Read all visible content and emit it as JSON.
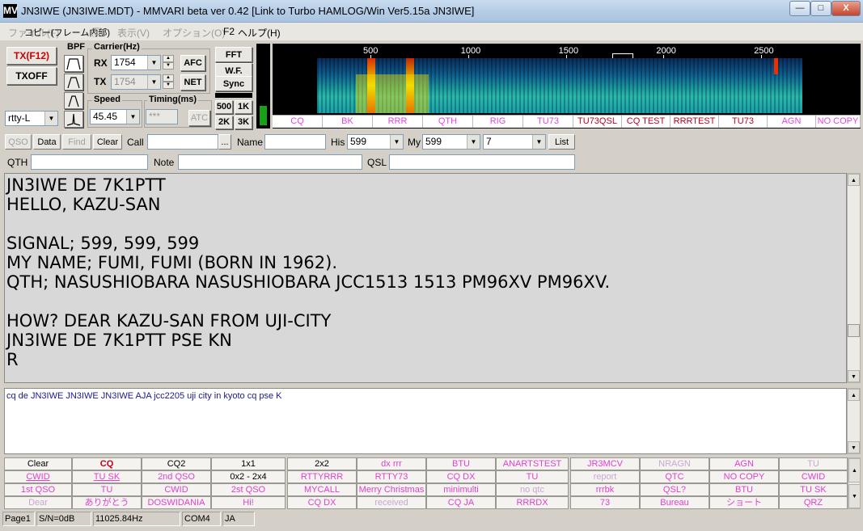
{
  "window": {
    "title": "JN3IWE (JN3IWE.MDT) - MMVARI beta ver 0.42 [Link to Turbo HAMLOG/Win Ver5.15a JN3IWE]",
    "icon_label": "MV",
    "minimize_label": "—",
    "maximize_label": "□",
    "close_label": "X"
  },
  "menu": [
    {
      "label": "ファイル(F)"
    },
    {
      "label": "コピー(フレーム内部)"
    },
    {
      "label": "(E)"
    },
    {
      "label": "表示(V)"
    },
    {
      "label": "オプション(O)"
    },
    {
      "label": "F2"
    },
    {
      "label": "ヘルプ(H)"
    }
  ],
  "controls": {
    "tx_button": "TX(F12)",
    "txoff_button": "TXOFF",
    "bpf_label": "BPF",
    "mode_value": "rtty-L",
    "carrier_label": "Carrier(Hz)",
    "rx_label": "RX",
    "rx_value": "1754",
    "tx_label": "TX",
    "tx_value": "1754",
    "afc_button": "AFC",
    "net_button": "NET",
    "speed_label": "Speed",
    "speed_value": "45.45",
    "timing_label": "Timing(ms)",
    "timing_value": "***",
    "atc_button": "ATC",
    "fft_button": "FFT",
    "wf_button": "W.F.",
    "sync_button": "Sync",
    "b500_button": "500",
    "b1k_button": "1K",
    "b2k_button": "2K",
    "b3k_button": "3K"
  },
  "spectrum": {
    "scale": [
      {
        "label": "500",
        "hz": 500
      },
      {
        "label": "1000",
        "hz": 1000
      },
      {
        "label": "1500",
        "hz": 1500
      },
      {
        "label": "2000",
        "hz": 2000
      },
      {
        "label": "2500",
        "hz": 2500
      }
    ],
    "quick_macros": [
      "CQ",
      "BK",
      "RRR",
      "QTH",
      "RIG",
      "TU73",
      "TU73QSL",
      "CQ TEST",
      "RRRTEST",
      "TU73",
      "AGN",
      "NO COPY"
    ]
  },
  "log": {
    "qso_button": "QSO",
    "data_button": "Data",
    "find_button": "Find",
    "clear_button": "Clear",
    "call_label": "Call",
    "call_value": "",
    "call_more": "...",
    "name_label": "Name",
    "name_value": "",
    "his_label": "His",
    "his_value": "599",
    "my_label": "My",
    "my_value": "599",
    "band_value": "7",
    "list_button": "List",
    "qth_label": "QTH",
    "qth_value": "",
    "note_label": "Note",
    "note_value": "",
    "qsl_label": "QSL",
    "qsl_value": ""
  },
  "rx_text": [
    " JN3IWE DE 7K1PTT",
    " HELLO, KAZU-SAN",
    "",
    " SIGNAL; 599, 599, 599",
    " MY NAME; FUMI, FUMI (BORN IN 1962).",
    " QTH; NASUSHIOBARA NASUSHIOBARA JCC1513 1513 PM96XV PM96XV.",
    "",
    " HOW? DEAR KAZU-SAN FROM UJI-CITY",
    " JN3IWE DE 7K1PTT PSE KN",
    "R"
  ],
  "tx_text": "cq de JN3IWE JN3IWE JN3IWE AJA jcc2205 uji city in kyoto cq pse K",
  "macros": [
    [
      {
        "label": "Clear",
        "style": "black"
      },
      {
        "label": "CQ",
        "style": "red"
      },
      {
        "label": "CQ2",
        "style": "black"
      },
      {
        "label": "1x1",
        "style": "black"
      },
      {
        "label": "2x2",
        "style": "black"
      },
      {
        "label": "dx rrr",
        "style": "pink"
      },
      {
        "label": "BTU",
        "style": "pink"
      },
      {
        "label": "ANARTSTEST",
        "style": "pink"
      },
      {
        "label": "JR3MCV",
        "style": "pink"
      },
      {
        "label": "NRAGN",
        "style": "gray"
      },
      {
        "label": "AGN",
        "style": "pink"
      },
      {
        "label": "TU",
        "style": "gray"
      }
    ],
    [
      {
        "label": "CWID",
        "style": "pink-u"
      },
      {
        "label": "TU SK",
        "style": "pink-u"
      },
      {
        "label": "2nd QSO",
        "style": "pink"
      },
      {
        "label": "0x2 - 2x4",
        "style": "black"
      },
      {
        "label": "RTTYRRR",
        "style": "pink"
      },
      {
        "label": "RTTY73",
        "style": "pink"
      },
      {
        "label": "CQ DX",
        "style": "pink"
      },
      {
        "label": "TU",
        "style": "pink"
      },
      {
        "label": "report",
        "style": "gray"
      },
      {
        "label": "QTC",
        "style": "pink"
      },
      {
        "label": "NO COPY",
        "style": "pink"
      },
      {
        "label": "CWID",
        "style": "pink"
      }
    ],
    [
      {
        "label": "1st QSO",
        "style": "pink"
      },
      {
        "label": "TU",
        "style": "pink"
      },
      {
        "label": "CWID",
        "style": "pink"
      },
      {
        "label": "2st QSO",
        "style": "pink"
      },
      {
        "label": "MYCALL",
        "style": "pink"
      },
      {
        "label": "Merry Christmas",
        "style": "pink"
      },
      {
        "label": "minimulti",
        "style": "pink"
      },
      {
        "label": "no qtc",
        "style": "gray"
      },
      {
        "label": "rrrbk",
        "style": "pink"
      },
      {
        "label": "QSL?",
        "style": "pink"
      },
      {
        "label": "BTU",
        "style": "pink"
      },
      {
        "label": "TU SK",
        "style": "pink"
      }
    ],
    [
      {
        "label": "Dear",
        "style": "gray"
      },
      {
        "label": "ありがとう",
        "style": "pink"
      },
      {
        "label": "DOSWIDANIA",
        "style": "pink"
      },
      {
        "label": "Hi!",
        "style": "pink"
      },
      {
        "label": "CQ DX",
        "style": "pink"
      },
      {
        "label": "received",
        "style": "gray"
      },
      {
        "label": "CQ JA",
        "style": "pink"
      },
      {
        "label": "RRRDX",
        "style": "pink"
      },
      {
        "label": "73",
        "style": "pink"
      },
      {
        "label": "Bureau",
        "style": "pink"
      },
      {
        "label": "ショート",
        "style": "pink"
      },
      {
        "label": "QRZ",
        "style": "pink"
      }
    ]
  ],
  "status": [
    {
      "label": "Page1"
    },
    {
      "label": "S/N=0dB"
    },
    {
      "label": "11025.84Hz"
    },
    {
      "label": "COM4"
    },
    {
      "label": "JA"
    }
  ],
  "colors": {
    "pink": "#e040d0",
    "red": "#c00020",
    "gray": "#c8a8d0",
    "black": "#000000"
  }
}
